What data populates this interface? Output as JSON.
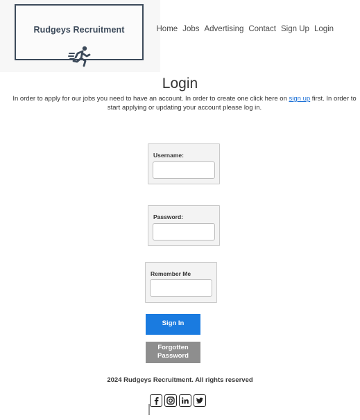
{
  "header": {
    "logo_text": "Rudgeys Recruitment",
    "nav": [
      "Home",
      "Jobs",
      "Advertising",
      "Contact",
      "Sign Up",
      "Login"
    ]
  },
  "main": {
    "title": "Login",
    "intro_part1": "In order to apply for our jobs you need to have an account. In order to create one click here on ",
    "intro_link": "sign up",
    "intro_part2": " first. In order to start applying or updating your account please log in.",
    "username_label": "Username:",
    "password_label": "Password:",
    "remember_label": "Remember Me",
    "signin_label": "Sign In",
    "forgot_line1": "Forgotten",
    "forgot_line2": "Password"
  },
  "footer": {
    "copyright": "2024 Rudgeys Recruitment. All rights reserved",
    "social_icons": [
      "facebook-icon",
      "instagram-icon",
      "linkedin-icon",
      "twitter-icon"
    ]
  },
  "colors": {
    "primary_button": "#1a7be0",
    "secondary_button": "#8e8e8e",
    "link": "#1a6fd6",
    "logo": "#3c4a5a"
  }
}
